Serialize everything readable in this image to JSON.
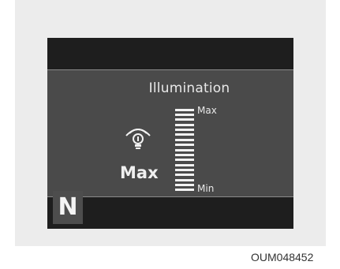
{
  "display": {
    "title": "Illumination",
    "level_label": "Max",
    "icon": "dashboard-illumination-icon",
    "gauge": {
      "max_label": "Max",
      "min_label": "Min",
      "segments_total": 17,
      "segments_lit": 17
    },
    "gear": "N"
  },
  "caption": "OUM048452"
}
